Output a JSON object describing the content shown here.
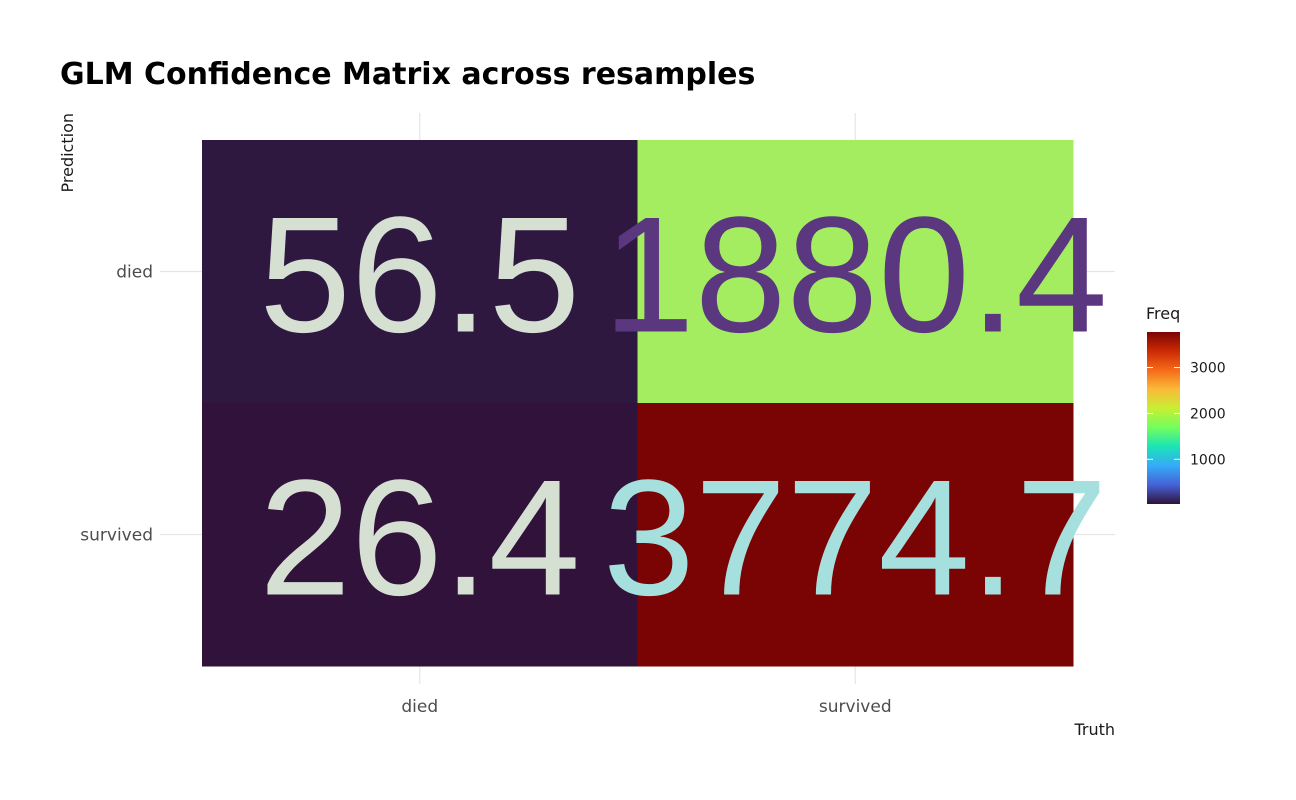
{
  "chart_data": {
    "type": "heatmap",
    "title": "GLM Confidence Matrix across resamples",
    "xlabel": "Truth",
    "ylabel": "Prediction",
    "x_categories": [
      "died",
      "survived"
    ],
    "y_categories": [
      "died",
      "survived"
    ],
    "cells": [
      {
        "truth": "died",
        "prediction": "died",
        "value": 56.5,
        "label": "56.5",
        "fill": "#2f1840",
        "text_color": "#d5e0d3"
      },
      {
        "truth": "survived",
        "prediction": "died",
        "value": 1880.4,
        "label": "1880.4",
        "fill": "#a4ed61",
        "text_color": "#5b3780"
      },
      {
        "truth": "died",
        "prediction": "survived",
        "value": 26.4,
        "label": "26.4",
        "fill": "#30123b",
        "text_color": "#d5e0d3"
      },
      {
        "truth": "survived",
        "prediction": "survived",
        "value": 3774.7,
        "label": "3774.7",
        "fill": "#7a0403",
        "text_color": "#a6e0de"
      }
    ],
    "legend": {
      "title": "Freq",
      "ticks": [
        1000,
        2000,
        3000
      ],
      "range": [
        26.4,
        3774.7
      ],
      "palette": [
        "#30123b",
        "#4662d7",
        "#36aaf9",
        "#1ae4b6",
        "#72fe5e",
        "#c7ef34",
        "#faba39",
        "#f66b19",
        "#cb2a04",
        "#7a0403"
      ]
    },
    "grid": true
  }
}
